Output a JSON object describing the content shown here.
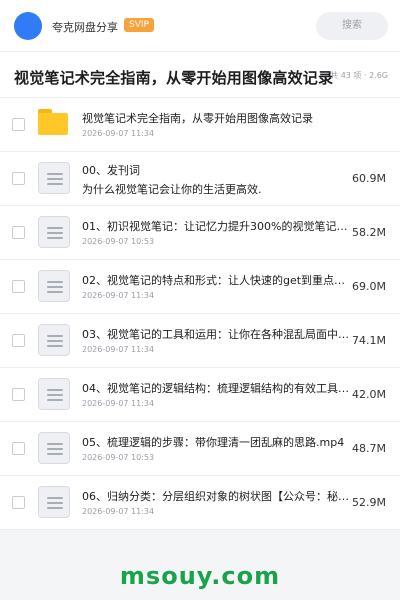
{
  "header": {
    "brand": "夸克网盘分享",
    "badge": "SVIP",
    "search_label": "搜索"
  },
  "title_bar": {
    "title": "视觉笔记术完全指南，从零开始用图像高效记录",
    "meta": "共 43 项 · 2.6G"
  },
  "files": [
    {
      "name": "视觉笔记术完全指南，从零开始用图像高效记录",
      "date": "2026-09-07 11:34",
      "size": "",
      "type": "folder"
    },
    {
      "name": "00、发刊词",
      "subtitle": "为什么视觉笔记会让你的生活更高效.",
      "date": "",
      "size": "60.9M",
      "type": "file"
    },
    {
      "name": "01、初识视觉笔记：让记忆力提升300%的视觉笔记…",
      "date": "2026-09-07 10:53",
      "size": "58.2M",
      "type": "file"
    },
    {
      "name": "02、视觉笔记的特点和形式：让人快速的get到重点…",
      "date": "2026-09-07 11:34",
      "size": "69.0M",
      "type": "file"
    },
    {
      "name": "03、视觉笔记的工具和运用：让你在各种混乱局面中不…",
      "date": "2026-09-07 11:34",
      "size": "74.1M",
      "type": "file"
    },
    {
      "name": "04、视觉笔记的逻辑结构：梳理逻辑结构的有效工具【…",
      "date": "2026-09-07 11:34",
      "size": "42.0M",
      "type": "file"
    },
    {
      "name": "05、梳理逻辑的步骤：带你理清一团乱麻的思路.mp4",
      "date": "2026-09-07 10:53",
      "size": "48.7M",
      "type": "file"
    },
    {
      "name": "06、归纳分类：分层组织对象的树状图【公众号：秘知…",
      "date": "2026-09-07 11:34",
      "size": "52.9M",
      "type": "file"
    }
  ],
  "watermark": "msouy.com",
  "colors": {
    "accent": "#2f7cf6",
    "badge": "#f7a23b",
    "folder": "#ffc727",
    "watermark": "#1aa34a"
  }
}
